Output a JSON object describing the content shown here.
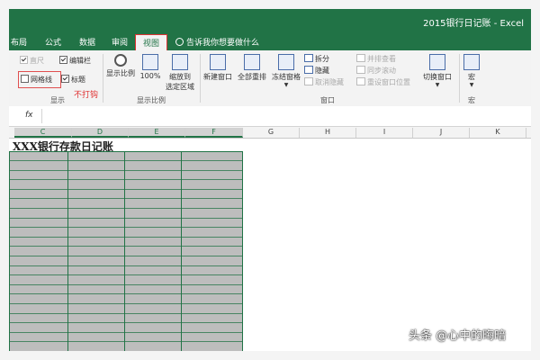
{
  "window": {
    "title": "2015银行日记账 - Excel"
  },
  "tabs": [
    {
      "label": "布局"
    },
    {
      "label": "公式"
    },
    {
      "label": "数据"
    },
    {
      "label": "审阅"
    },
    {
      "label": "视图",
      "active": true
    }
  ],
  "tell_me": {
    "placeholder": "告诉我你想要做什么"
  },
  "ribbon": {
    "show_group": {
      "label": "显示",
      "ruler": "直尺",
      "formula_bar": "编辑栏",
      "gridlines": "网格线",
      "headings": "标题",
      "annotation": "不打钩"
    },
    "zoom_group": {
      "label": "显示比例",
      "zoom": "显示比例",
      "zoom_100": "100%",
      "zoom_selection_line1": "缩放到",
      "zoom_selection_line2": "选定区域"
    },
    "window_group": {
      "label": "窗口",
      "new_window": "新建窗口",
      "arrange_all": "全部重排",
      "freeze_panes": "冻结窗格",
      "split": "拆分",
      "hide": "隐藏",
      "unhide": "取消隐藏",
      "view_side_by_side": "并排查看",
      "sync_scroll": "同步滚动",
      "reset_position": "重设窗口位置",
      "switch_windows": "切换窗口"
    },
    "macros_group": {
      "label": "宏",
      "macros": "宏"
    }
  },
  "formula_bar": {
    "fx": "fx"
  },
  "columns": [
    "C",
    "D",
    "E",
    "F",
    "G",
    "H",
    "I",
    "J",
    "K"
  ],
  "sheet": {
    "title": "XXX银行存款日记账"
  },
  "watermark": "头条 @心中的晦暗",
  "colors": {
    "excel_green": "#217346",
    "highlight_red": "#e05050",
    "cell_gray": "#bdbdbd"
  }
}
